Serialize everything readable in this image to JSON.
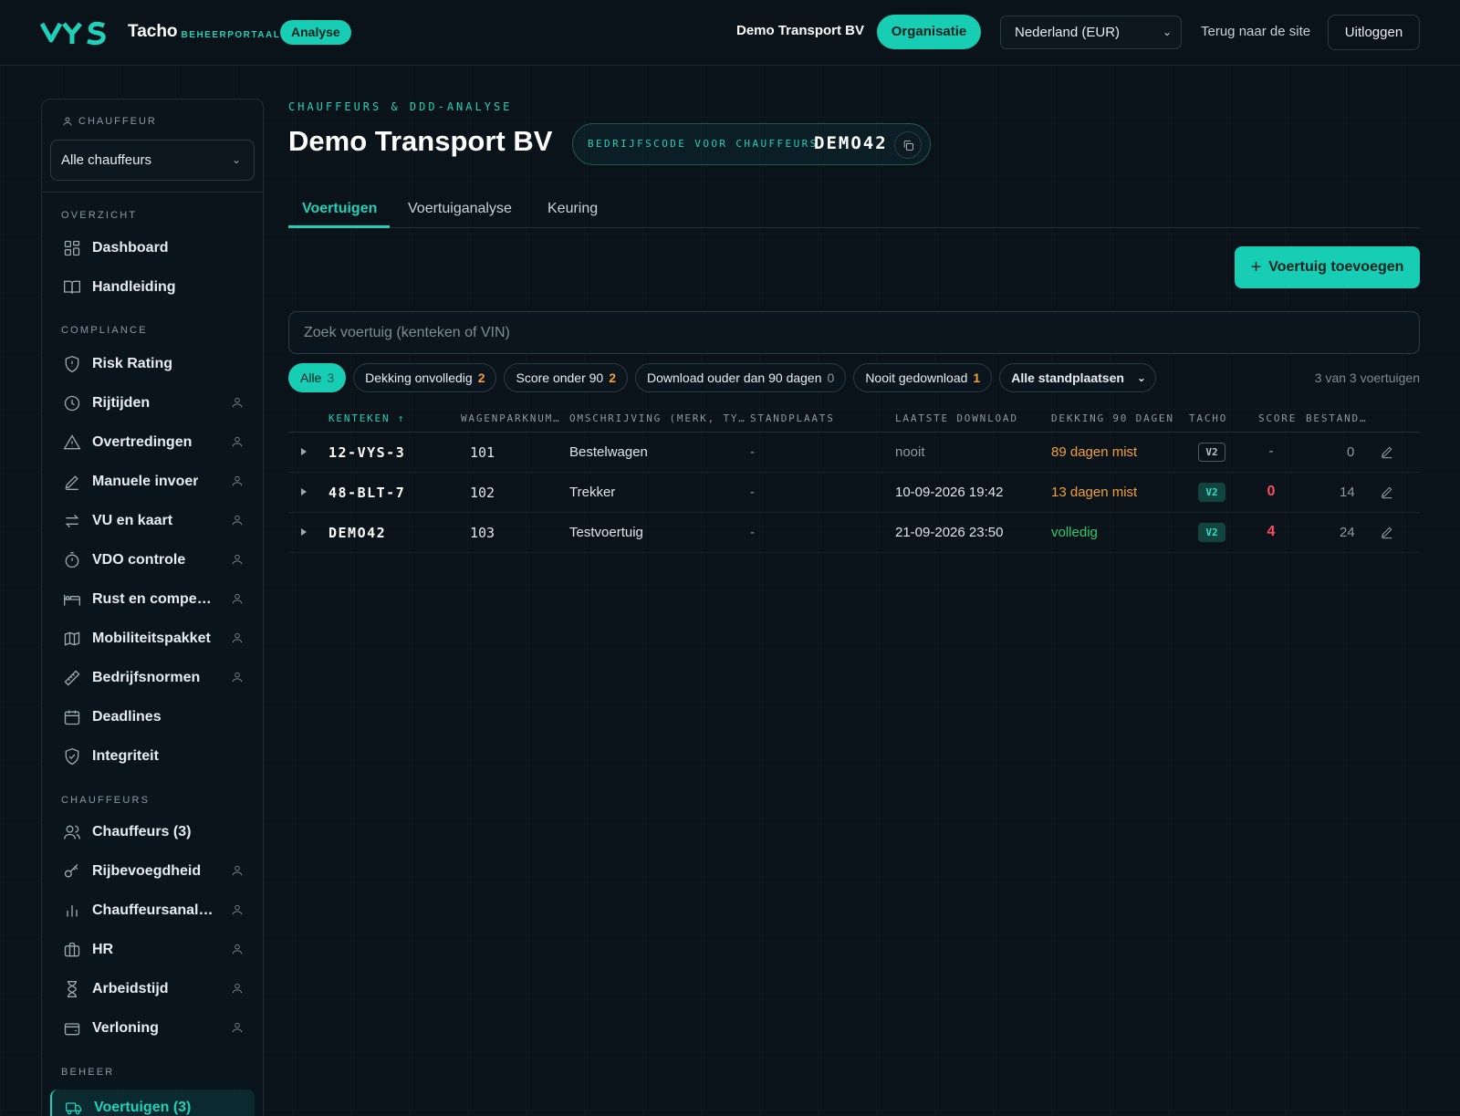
{
  "header": {
    "logo_text": "VYS",
    "app_name": "Tacho",
    "app_subtitle": "BEHEERPORTAAL",
    "analyse_badge": "Analyse",
    "org_name": "Demo Transport BV",
    "org_button": "Organisatie",
    "country_select": "Nederland (EUR)",
    "back_link": "Terug naar de site",
    "logout": "Uitloggen"
  },
  "sidebar": {
    "chauffeur_label": "CHAUFFEUR",
    "chauffeur_select": "Alle chauffeurs",
    "sections": {
      "overzicht": "OVERZICHT",
      "compliance": "COMPLIANCE",
      "chauffeurs": "CHAUFFEURS",
      "beheer": "BEHEER"
    },
    "items": [
      {
        "label": "Dashboard",
        "icon": "dashboard-icon"
      },
      {
        "label": "Handleiding",
        "icon": "book-icon"
      },
      {
        "label": "Risk Rating",
        "icon": "shield-icon"
      },
      {
        "label": "Rijtijden",
        "icon": "clock-icon"
      },
      {
        "label": "Overtredingen",
        "icon": "warning-icon"
      },
      {
        "label": "Manuele invoer",
        "icon": "pencil-icon"
      },
      {
        "label": "VU en kaart",
        "icon": "transfer-icon"
      },
      {
        "label": "VDO controle",
        "icon": "timer-icon"
      },
      {
        "label": "Rust en compen…",
        "icon": "bed-icon"
      },
      {
        "label": "Mobiliteitspakket",
        "icon": "map-icon"
      },
      {
        "label": "Bedrijfsnormen",
        "icon": "ruler-icon"
      },
      {
        "label": "Deadlines",
        "icon": "calendar-icon"
      },
      {
        "label": "Integriteit",
        "icon": "shield-check-icon"
      },
      {
        "label": "Chauffeurs (3)",
        "icon": "users-icon"
      },
      {
        "label": "Rijbevoegdheid",
        "icon": "key-icon"
      },
      {
        "label": "Chauffeursanaly…",
        "icon": "bar-chart-icon"
      },
      {
        "label": "HR",
        "icon": "briefcase-icon"
      },
      {
        "label": "Arbeidstijd",
        "icon": "hourglass-icon"
      },
      {
        "label": "Verloning",
        "icon": "wallet-icon"
      },
      {
        "label": "Voertuigen (3)",
        "icon": "truck-icon"
      }
    ]
  },
  "main": {
    "kicker": "CHAUFFEURS & DDD-ANALYSE",
    "title": "Demo Transport BV",
    "company_code_label": "BEDRIJFSCODE VOOR CHAUFFEURS",
    "company_code": "DEMO42",
    "tabs": [
      "Voertuigen",
      "Voertuiganalyse",
      "Keuring"
    ],
    "add_button": "Voertuig toevoegen",
    "search_placeholder": "Zoek voertuig (kenteken of VIN)",
    "filters": [
      {
        "label": "Alle",
        "count": "3"
      },
      {
        "label": "Dekking onvolledig",
        "count": "2"
      },
      {
        "label": "Score onder 90",
        "count": "2"
      },
      {
        "label": "Download ouder dan 90 dagen",
        "count": "0"
      },
      {
        "label": "Nooit gedownload",
        "count": "1"
      }
    ],
    "location_select": "Alle standplaatsen",
    "result_count": "3 van 3 voertuigen",
    "table": {
      "columns": [
        "KENTEKEN ↑",
        "WAGENPARKNUM…",
        "OMSCHRIJVING (MERK, TY…",
        "STANDPLAATS",
        "LAATSTE DOWNLOAD",
        "DEKKING 90 DAGEN",
        "TACHO",
        "SCORE",
        "BESTAND…"
      ],
      "rows": [
        {
          "plate": "12-VYS-3",
          "fleet": "101",
          "desc": "Bestelwagen",
          "location": "-",
          "last_download": "nooit",
          "coverage": "89 dagen mist",
          "tacho": "V2",
          "score": "-",
          "files": "0"
        },
        {
          "plate": "48-BLT-7",
          "fleet": "102",
          "desc": "Trekker",
          "location": "-",
          "last_download": "10-09-2026 19:42",
          "coverage": "13 dagen mist",
          "tacho": "V2",
          "score": "0",
          "files": "14"
        },
        {
          "plate": "DEMO42",
          "fleet": "103",
          "desc": "Testvoertuig",
          "location": "-",
          "last_download": "21-09-2026 23:50",
          "coverage": "volledig",
          "tacho": "V2",
          "score": "4",
          "files": "24"
        }
      ]
    }
  },
  "colors": {
    "accent": "#17cdb4",
    "warning": "#f2a03a",
    "danger": "#ff4d5e",
    "success": "#2ecc71",
    "background": "#0a121a"
  }
}
